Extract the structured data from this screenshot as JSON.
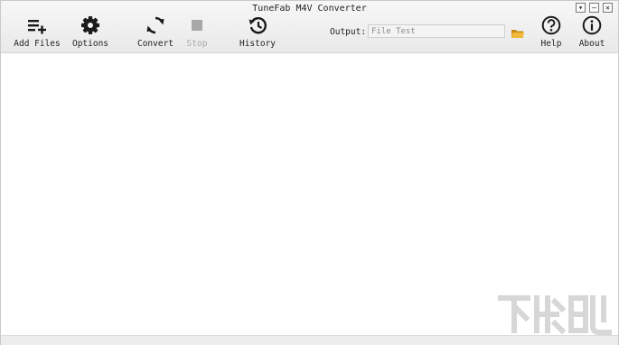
{
  "window": {
    "title": "TuneFab M4V Converter"
  },
  "window_controls": {
    "menu": "▾",
    "minimize": "–",
    "close": "✕"
  },
  "toolbar": {
    "add_files": {
      "label": "Add Files",
      "icon": "add-files-icon"
    },
    "options": {
      "label": "Options",
      "icon": "gear-icon"
    },
    "convert": {
      "label": "Convert",
      "icon": "refresh-icon"
    },
    "stop": {
      "label": "Stop",
      "icon": "stop-icon",
      "disabled": true
    },
    "history": {
      "label": "History",
      "icon": "history-icon"
    },
    "help": {
      "label": "Help",
      "icon": "question-icon"
    },
    "about": {
      "label": "About",
      "icon": "info-icon"
    }
  },
  "output": {
    "label": "Output:",
    "value": "File Test",
    "folder_icon": "folder-icon"
  },
  "watermark": {
    "site": "www.xiazaiba.com"
  },
  "colors": {
    "toolbar_bg": "#efefef",
    "icon": "#1a1a1a",
    "disabled": "#a8a8a8",
    "folder": "#e0a020"
  }
}
